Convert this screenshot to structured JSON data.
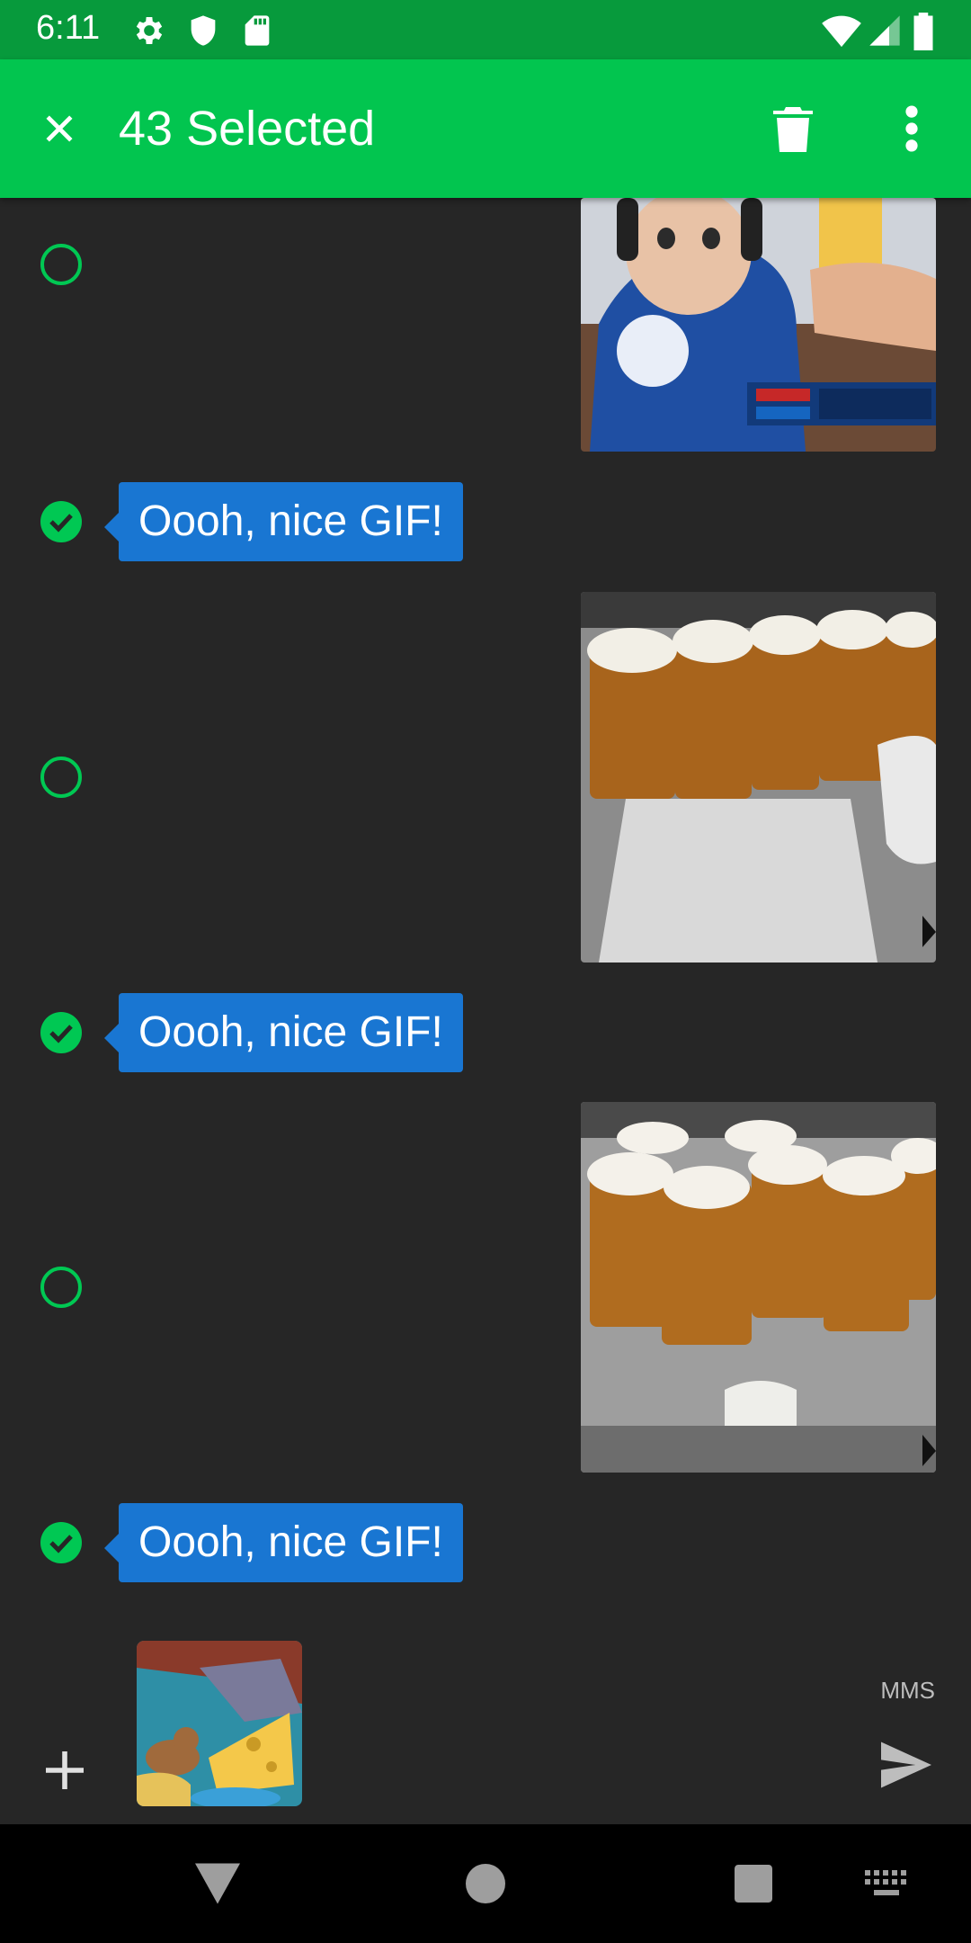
{
  "status_bar": {
    "time": "6:11",
    "left_icons": [
      "settings-icon",
      "shield-icon",
      "sd-card-icon"
    ],
    "right_icons": [
      "wifi-icon",
      "cell-signal-icon",
      "battery-icon"
    ]
  },
  "app_bar": {
    "title": "43 Selected",
    "close_icon": "close-icon",
    "delete_icon": "trash-icon",
    "more_icon": "more-vert-icon",
    "color": "#02c54f"
  },
  "messages": [
    {
      "type": "gif",
      "selected": false,
      "description_icon": "baby-blue-jays-gif"
    },
    {
      "type": "text",
      "selected": true,
      "text": "Oooh, nice GIF!"
    },
    {
      "type": "gif",
      "selected": false,
      "description_icon": "beer-steins-gif"
    },
    {
      "type": "text",
      "selected": true,
      "text": "Oooh, nice GIF!"
    },
    {
      "type": "gif",
      "selected": false,
      "description_icon": "beer-steins-gif"
    },
    {
      "type": "text",
      "selected": true,
      "text": "Oooh, nice GIF!"
    }
  ],
  "composer": {
    "add_icon": "plus-icon",
    "attachment_icon": "cartoon-mouse-cheese-gif",
    "mode_label": "MMS",
    "send_icon": "send-icon"
  },
  "nav_bar": {
    "buttons": [
      "back-icon",
      "home-icon",
      "recents-icon",
      "keyboard-icon"
    ]
  },
  "colors": {
    "accent_green": "#02c54f",
    "bubble_blue": "#1976d2",
    "background": "#262626"
  }
}
